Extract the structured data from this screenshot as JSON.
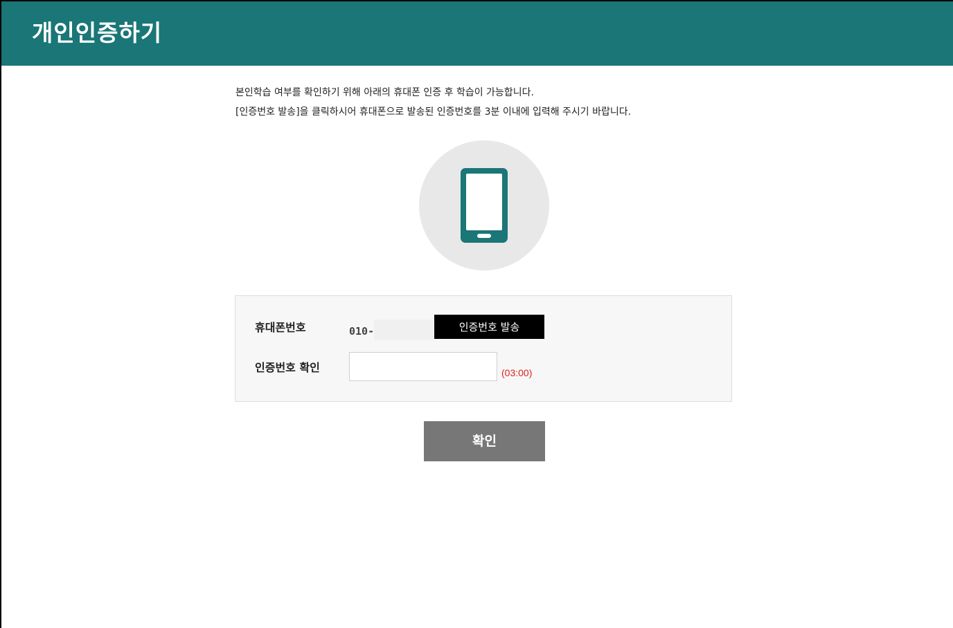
{
  "header": {
    "title": "개인인증하기"
  },
  "intro": {
    "line1": "본인학습 여부를 확인하기 위해 아래의 휴대폰 인증 후 학습이 가능합니다.",
    "line2": "[인증번호 발송]을 클릭하시어 휴대폰으로 발송된 인증번호를 3분 이내에 입력해 주시기 바랍니다."
  },
  "icon": {
    "name": "smartphone-icon",
    "color": "#1a7677",
    "background": "#e8e8e8"
  },
  "form": {
    "phone_label": "휴대폰번호",
    "phone_prefix": "010-",
    "send_button_label": "인증번호 발송",
    "code_label": "인증번호 확인",
    "code_value": "",
    "timer": "(03:00)"
  },
  "confirm_button_label": "확인",
  "colors": {
    "header": "#1a7677",
    "timer": "#e02020",
    "confirm_button": "#777777",
    "send_button": "#000000"
  }
}
